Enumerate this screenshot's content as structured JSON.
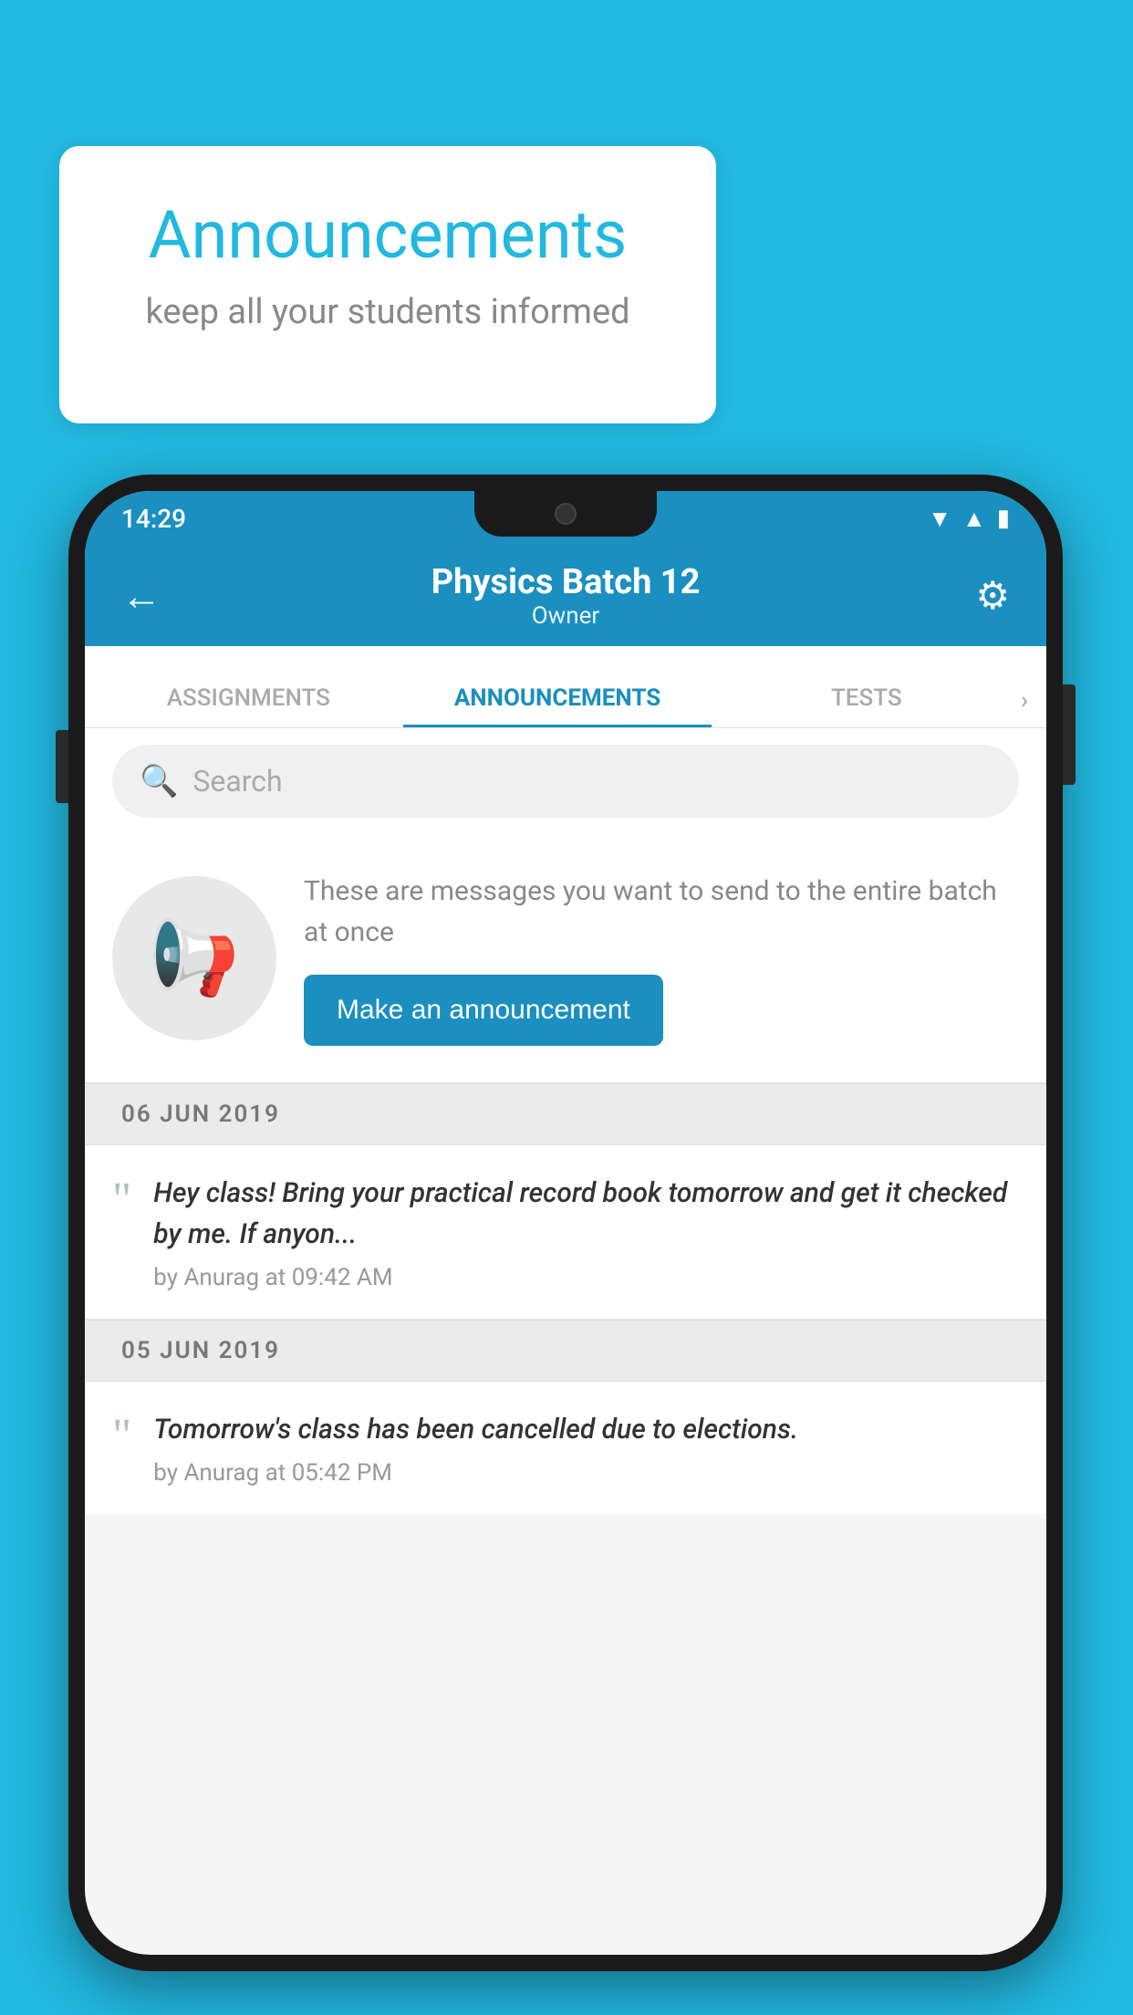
{
  "page": {
    "background_color": "#22b8e0"
  },
  "speech_bubble": {
    "title": "Announcements",
    "subtitle": "keep all your students informed"
  },
  "status_bar": {
    "time": "14:29",
    "wifi": "▲",
    "signal": "▲",
    "battery": "▮"
  },
  "app_bar": {
    "back_label": "←",
    "title": "Physics Batch 12",
    "subtitle": "Owner",
    "settings_icon": "⚙"
  },
  "tabs": [
    {
      "label": "ASSIGNMENTS",
      "active": false
    },
    {
      "label": "ANNOUNCEMENTS",
      "active": true
    },
    {
      "label": "TESTS",
      "active": false
    },
    {
      "label": "›",
      "active": false
    }
  ],
  "search": {
    "placeholder": "Search"
  },
  "promo": {
    "description": "These are messages you want to send to the entire batch at once",
    "button_label": "Make an announcement"
  },
  "announcements": [
    {
      "date": "06  JUN  2019",
      "text": "Hey class! Bring your practical record book tomorrow and get it checked by me. If anyon...",
      "meta": "by Anurag at 09:42 AM"
    },
    {
      "date": "05  JUN  2019",
      "text": "Tomorrow's class has been cancelled due to elections.",
      "meta": "by Anurag at 05:42 PM"
    }
  ]
}
